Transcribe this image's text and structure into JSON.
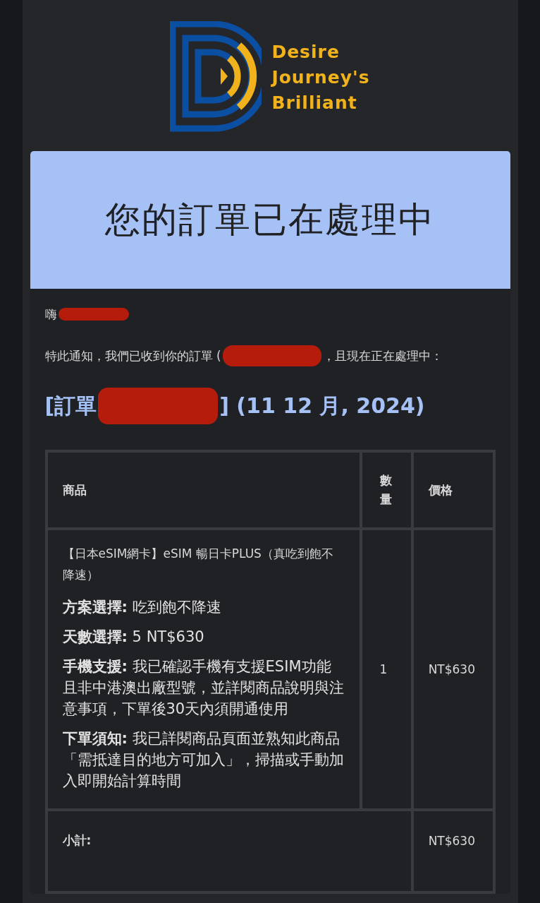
{
  "logo": {
    "lines": [
      "Desire",
      "Journey's",
      "Brilliant"
    ]
  },
  "banner": {
    "title": "您的訂單已在處理中"
  },
  "greeting": {
    "text": "嗨",
    "redacted": true
  },
  "notice": {
    "before": "特此通知，我們已收到你的訂單 (",
    "redacted": true,
    "after": "，且現在正在處理中："
  },
  "order_heading": {
    "before": "[訂單",
    "redacted": true,
    "after": "] (11 12 月, 2024)"
  },
  "table": {
    "columns": [
      "商品",
      "數量",
      "價格"
    ],
    "rows": [
      {
        "product": "【日本eSIM網卡】eSIM 暢日卡PLUS（真吃到飽不降速）",
        "options": [
          {
            "label": "方案選擇:",
            "value": "吃到飽不降速"
          },
          {
            "label": "天數選擇:",
            "value": "5 NT$630"
          },
          {
            "label": "手機支援:",
            "value": "我已確認手機有支援ESIM功能且非中港澳出廠型號，並詳閱商品說明與注意事項，下單後30天內須開通使用"
          },
          {
            "label": "下單須知:",
            "value": "我已詳閱商品頁面並熟知此商品「需抵達目的地方可加入」，掃描或手動加入即開始計算時間"
          }
        ],
        "quantity": "1",
        "price": "NT$630"
      }
    ],
    "totals": [
      {
        "label": "小計:",
        "value": "NT$630"
      }
    ]
  }
}
